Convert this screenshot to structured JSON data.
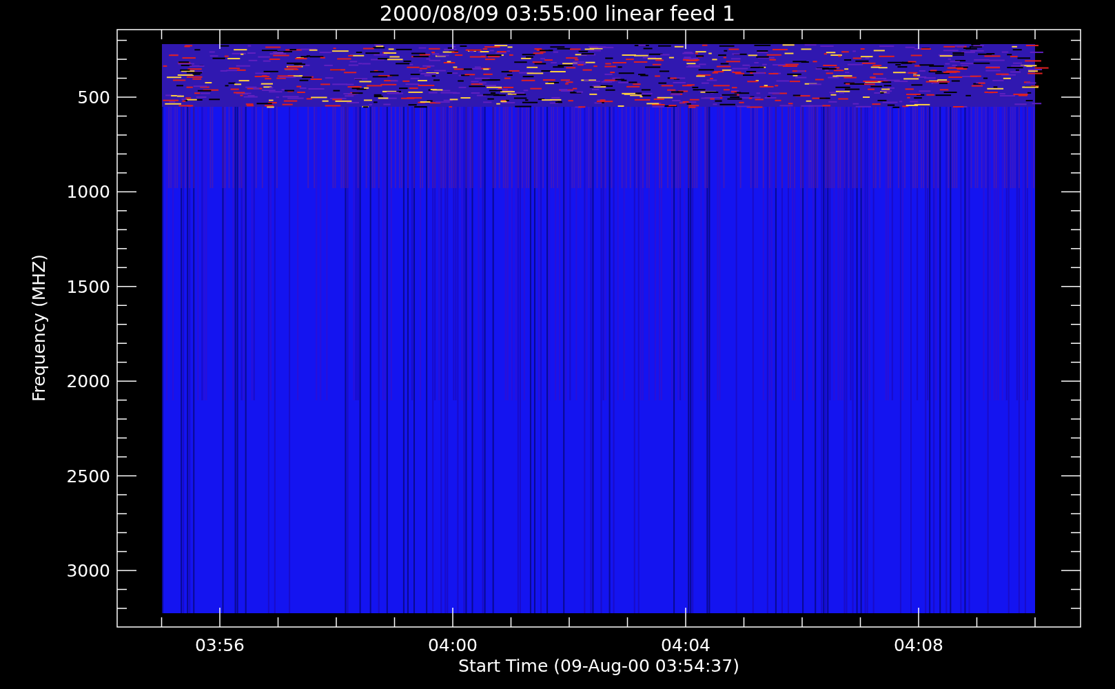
{
  "title": "2000/08/09 03:55:00 linear feed 1",
  "y_axis": {
    "label": "Frequency (MHZ)",
    "ticks": [
      "500",
      "1000",
      "1500",
      "2000",
      "2500",
      "3000"
    ]
  },
  "x_axis": {
    "label": "Start Time (09-Aug-00 03:54:37)",
    "ticks": [
      "03:56",
      "04:00",
      "04:04",
      "04:08"
    ]
  }
}
